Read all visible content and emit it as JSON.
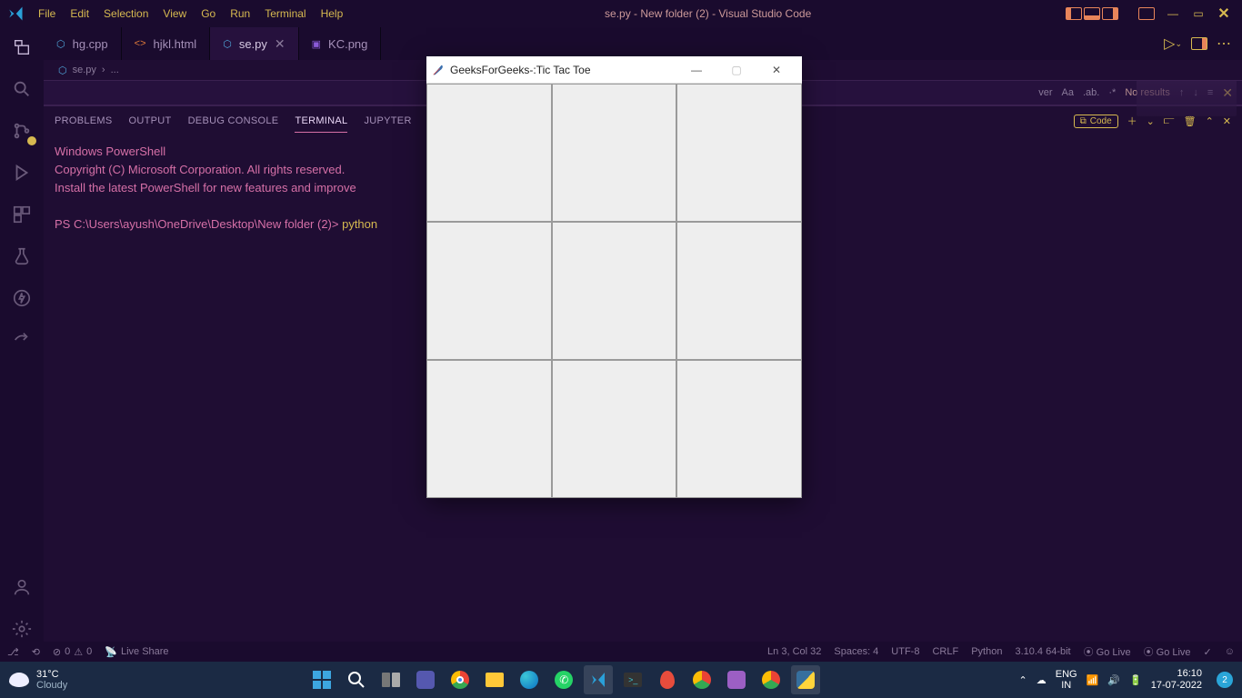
{
  "titlebar": {
    "menu": [
      "File",
      "Edit",
      "Selection",
      "View",
      "Go",
      "Run",
      "Terminal",
      "Help"
    ],
    "title": "se.py - New folder (2) - Visual Studio Code",
    "controls": {
      "minimize": "—",
      "maximize": "▭",
      "close": "✕"
    }
  },
  "tabs": [
    {
      "icon": "⬡",
      "label": "hg.cpp",
      "active": false,
      "icon_color": "#4ea3d7"
    },
    {
      "icon": "<>",
      "label": "hjkl.html",
      "active": false,
      "icon_color": "#e07a3a"
    },
    {
      "icon": "⬡",
      "label": "se.py",
      "active": true,
      "icon_color": "#4ea3d7"
    },
    {
      "icon": "▣",
      "label": "KC.png",
      "active": false,
      "icon_color": "#8a5ad8"
    }
  ],
  "tab_run_icon": "▷",
  "breadcrumb": {
    "icon": "⬡",
    "file": "se.py",
    "sep": "›",
    "more": "..."
  },
  "searchrow": {
    "partial": "ver",
    "options": [
      "Aa",
      ".ab.",
      "·*"
    ],
    "noresults": "No results",
    "arrows": [
      "↑",
      "↓",
      "≡"
    ],
    "close": "✕"
  },
  "panel": {
    "tabs": [
      "PROBLEMS",
      "OUTPUT",
      "DEBUG CONSOLE",
      "TERMINAL",
      "JUPYTER"
    ],
    "active": "TERMINAL",
    "code_label": "Code",
    "right_icons": [
      "＋",
      "⌄",
      "⫍",
      "🗑",
      "⌃",
      "✕"
    ],
    "terminal_lines": [
      "Windows PowerShell",
      "Copyright (C) Microsoft Corporation. All rights reserved.",
      "",
      "Install the latest PowerShell for new features and improve"
    ],
    "prompt": "PS C:\\Users\\ayush\\OneDrive\\Desktop\\New folder (2)> ",
    "cmd": "python"
  },
  "statusbar": {
    "left": [
      {
        "icon": "⎇",
        "text": ""
      },
      {
        "icon": "⟲",
        "text": ""
      },
      {
        "icon": "⊘",
        "text": "0"
      },
      {
        "icon": "⚠",
        "text": "0"
      },
      {
        "icon": "📡",
        "text": "Live Share"
      }
    ],
    "right": [
      "Ln 3, Col 32",
      "Spaces: 4",
      "UTF-8",
      "CRLF",
      "Python",
      "3.10.4 64-bit",
      "⦿ Go Live",
      "⦿ Go Live",
      "✓",
      "☺"
    ]
  },
  "ttt": {
    "title": "GeeksForGeeks-:Tic Tac Toe",
    "controls": {
      "min": "—",
      "max": "▢",
      "close": "✕"
    }
  },
  "taskbar": {
    "temp": "31°C",
    "weather": "Cloudy",
    "tray": {
      "lang_top": "ENG",
      "lang_bot": "IN",
      "time": "16:10",
      "date": "17-07-2022",
      "notif": "2",
      "up": "⌃"
    },
    "center_icons": [
      "win",
      "search",
      "tasks",
      "teams",
      "chrome",
      "files",
      "edge",
      "whatsapp",
      "vscode",
      "term",
      "maps",
      "chrome2",
      "app1",
      "chrome3",
      "python"
    ]
  }
}
